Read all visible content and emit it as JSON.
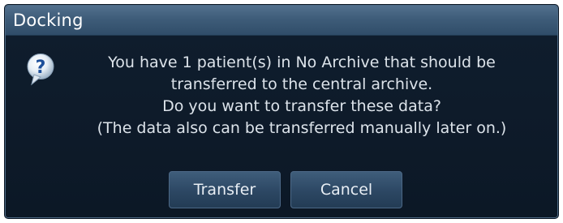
{
  "dialog": {
    "title": "Docking",
    "icon": "question-icon",
    "message": {
      "line1": "You have 1 patient(s) in No Archive that should be",
      "line2": "transferred to the central archive.",
      "line3": "Do you want to transfer these data?",
      "line4": "(The data also can be transferred manually later on.)"
    },
    "buttons": {
      "transfer_label": "Transfer",
      "cancel_label": "Cancel"
    }
  },
  "colors": {
    "titlebar": "#3e5c79",
    "body_background": "#0e1b2a",
    "button": "#2c4763",
    "text": "#dce3ea"
  }
}
